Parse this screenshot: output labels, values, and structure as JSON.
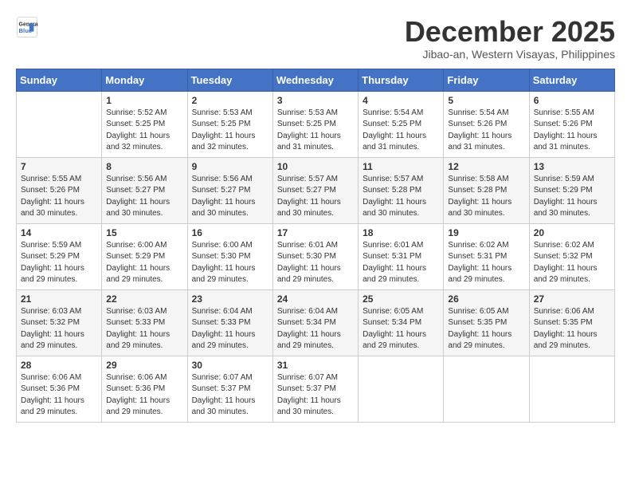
{
  "header": {
    "logo_line1": "General",
    "logo_line2": "Blue",
    "month_title": "December 2025",
    "subtitle": "Jibao-an, Western Visayas, Philippines"
  },
  "weekdays": [
    "Sunday",
    "Monday",
    "Tuesday",
    "Wednesday",
    "Thursday",
    "Friday",
    "Saturday"
  ],
  "weeks": [
    [
      {
        "day": "",
        "info": ""
      },
      {
        "day": "1",
        "info": "Sunrise: 5:52 AM\nSunset: 5:25 PM\nDaylight: 11 hours\nand 32 minutes."
      },
      {
        "day": "2",
        "info": "Sunrise: 5:53 AM\nSunset: 5:25 PM\nDaylight: 11 hours\nand 32 minutes."
      },
      {
        "day": "3",
        "info": "Sunrise: 5:53 AM\nSunset: 5:25 PM\nDaylight: 11 hours\nand 31 minutes."
      },
      {
        "day": "4",
        "info": "Sunrise: 5:54 AM\nSunset: 5:25 PM\nDaylight: 11 hours\nand 31 minutes."
      },
      {
        "day": "5",
        "info": "Sunrise: 5:54 AM\nSunset: 5:26 PM\nDaylight: 11 hours\nand 31 minutes."
      },
      {
        "day": "6",
        "info": "Sunrise: 5:55 AM\nSunset: 5:26 PM\nDaylight: 11 hours\nand 31 minutes."
      }
    ],
    [
      {
        "day": "7",
        "info": "Sunrise: 5:55 AM\nSunset: 5:26 PM\nDaylight: 11 hours\nand 30 minutes."
      },
      {
        "day": "8",
        "info": "Sunrise: 5:56 AM\nSunset: 5:27 PM\nDaylight: 11 hours\nand 30 minutes."
      },
      {
        "day": "9",
        "info": "Sunrise: 5:56 AM\nSunset: 5:27 PM\nDaylight: 11 hours\nand 30 minutes."
      },
      {
        "day": "10",
        "info": "Sunrise: 5:57 AM\nSunset: 5:27 PM\nDaylight: 11 hours\nand 30 minutes."
      },
      {
        "day": "11",
        "info": "Sunrise: 5:57 AM\nSunset: 5:28 PM\nDaylight: 11 hours\nand 30 minutes."
      },
      {
        "day": "12",
        "info": "Sunrise: 5:58 AM\nSunset: 5:28 PM\nDaylight: 11 hours\nand 30 minutes."
      },
      {
        "day": "13",
        "info": "Sunrise: 5:59 AM\nSunset: 5:29 PM\nDaylight: 11 hours\nand 30 minutes."
      }
    ],
    [
      {
        "day": "14",
        "info": "Sunrise: 5:59 AM\nSunset: 5:29 PM\nDaylight: 11 hours\nand 29 minutes."
      },
      {
        "day": "15",
        "info": "Sunrise: 6:00 AM\nSunset: 5:29 PM\nDaylight: 11 hours\nand 29 minutes."
      },
      {
        "day": "16",
        "info": "Sunrise: 6:00 AM\nSunset: 5:30 PM\nDaylight: 11 hours\nand 29 minutes."
      },
      {
        "day": "17",
        "info": "Sunrise: 6:01 AM\nSunset: 5:30 PM\nDaylight: 11 hours\nand 29 minutes."
      },
      {
        "day": "18",
        "info": "Sunrise: 6:01 AM\nSunset: 5:31 PM\nDaylight: 11 hours\nand 29 minutes."
      },
      {
        "day": "19",
        "info": "Sunrise: 6:02 AM\nSunset: 5:31 PM\nDaylight: 11 hours\nand 29 minutes."
      },
      {
        "day": "20",
        "info": "Sunrise: 6:02 AM\nSunset: 5:32 PM\nDaylight: 11 hours\nand 29 minutes."
      }
    ],
    [
      {
        "day": "21",
        "info": "Sunrise: 6:03 AM\nSunset: 5:32 PM\nDaylight: 11 hours\nand 29 minutes."
      },
      {
        "day": "22",
        "info": "Sunrise: 6:03 AM\nSunset: 5:33 PM\nDaylight: 11 hours\nand 29 minutes."
      },
      {
        "day": "23",
        "info": "Sunrise: 6:04 AM\nSunset: 5:33 PM\nDaylight: 11 hours\nand 29 minutes."
      },
      {
        "day": "24",
        "info": "Sunrise: 6:04 AM\nSunset: 5:34 PM\nDaylight: 11 hours\nand 29 minutes."
      },
      {
        "day": "25",
        "info": "Sunrise: 6:05 AM\nSunset: 5:34 PM\nDaylight: 11 hours\nand 29 minutes."
      },
      {
        "day": "26",
        "info": "Sunrise: 6:05 AM\nSunset: 5:35 PM\nDaylight: 11 hours\nand 29 minutes."
      },
      {
        "day": "27",
        "info": "Sunrise: 6:06 AM\nSunset: 5:35 PM\nDaylight: 11 hours\nand 29 minutes."
      }
    ],
    [
      {
        "day": "28",
        "info": "Sunrise: 6:06 AM\nSunset: 5:36 PM\nDaylight: 11 hours\nand 29 minutes."
      },
      {
        "day": "29",
        "info": "Sunrise: 6:06 AM\nSunset: 5:36 PM\nDaylight: 11 hours\nand 29 minutes."
      },
      {
        "day": "30",
        "info": "Sunrise: 6:07 AM\nSunset: 5:37 PM\nDaylight: 11 hours\nand 30 minutes."
      },
      {
        "day": "31",
        "info": "Sunrise: 6:07 AM\nSunset: 5:37 PM\nDaylight: 11 hours\nand 30 minutes."
      },
      {
        "day": "",
        "info": ""
      },
      {
        "day": "",
        "info": ""
      },
      {
        "day": "",
        "info": ""
      }
    ]
  ]
}
